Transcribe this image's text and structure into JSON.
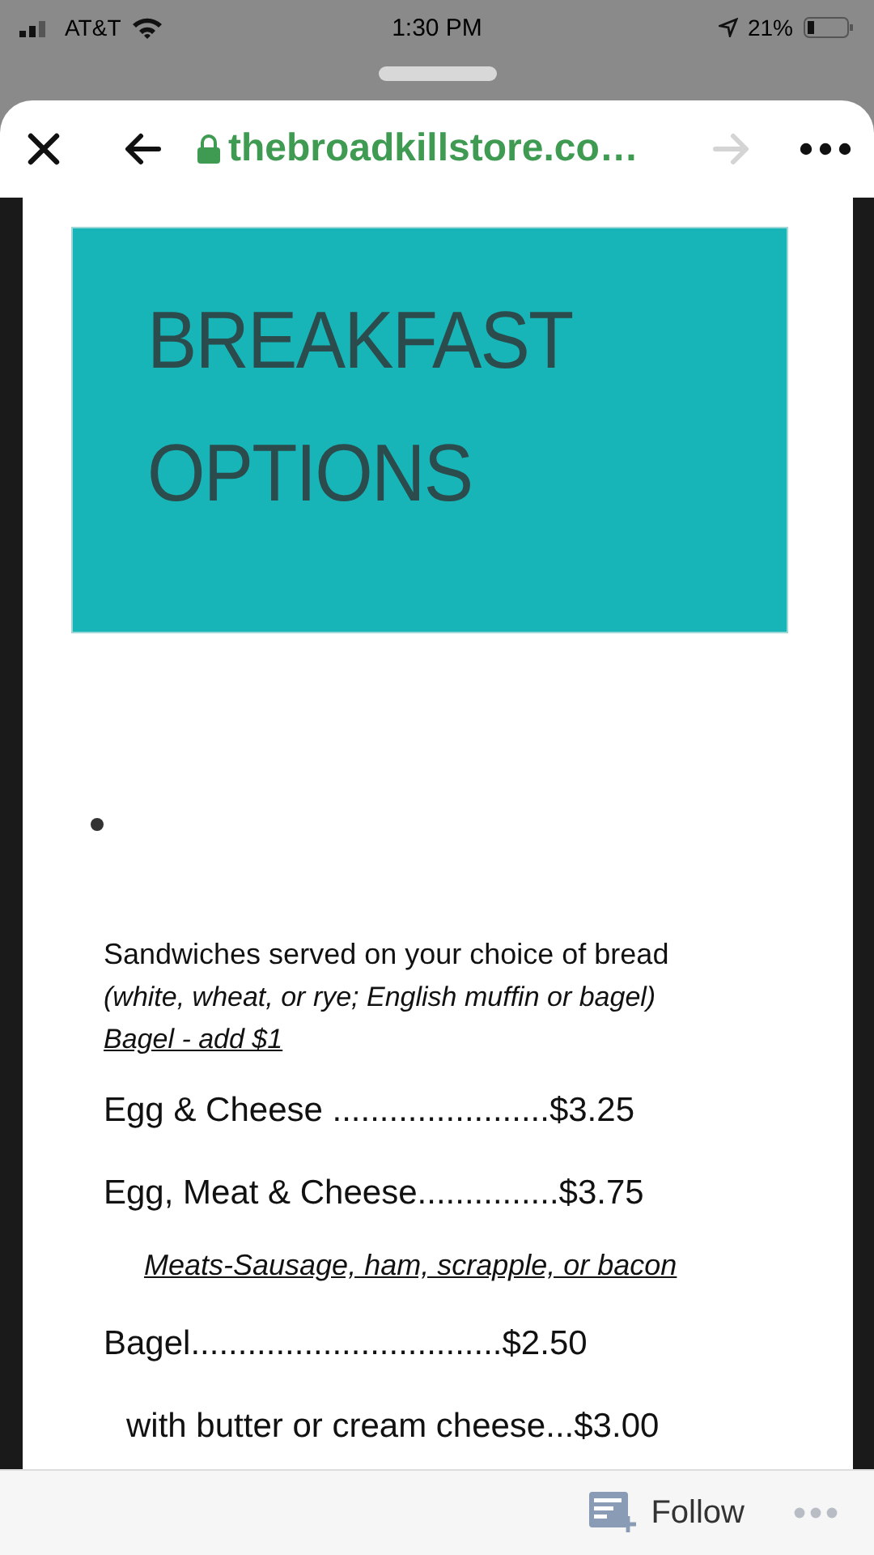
{
  "status_bar": {
    "carrier": "AT&T",
    "time": "1:30 PM",
    "battery": "21%"
  },
  "browser": {
    "url": "thebroadkillstore.co…",
    "forward_enabled": false
  },
  "banner": {
    "lines": [
      "BREAKFAST",
      "OPTIONS"
    ]
  },
  "menu": [
    {
      "kind": "note",
      "text": "Sandwiches served on your choice of bread"
    },
    {
      "kind": "italic",
      "text": "(white, wheat, or rye; English muffin or bagel)"
    },
    {
      "kind": "underlined",
      "text": "Bagel - add $1"
    },
    {
      "kind": "item",
      "text": "Egg & Cheese .......................$3.25"
    },
    {
      "kind": "item",
      "text": "Egg, Meat & Cheese...............$3.75"
    },
    {
      "kind": "subnote",
      "text": "Meats-Sausage, ham, scrapple, or bacon"
    },
    {
      "kind": "item",
      "text": "Bagel.................................$2.50"
    },
    {
      "kind": "subitem",
      "text": "with butter or cream cheese...$3.00"
    }
  ],
  "footer": {
    "follow": "Follow"
  }
}
